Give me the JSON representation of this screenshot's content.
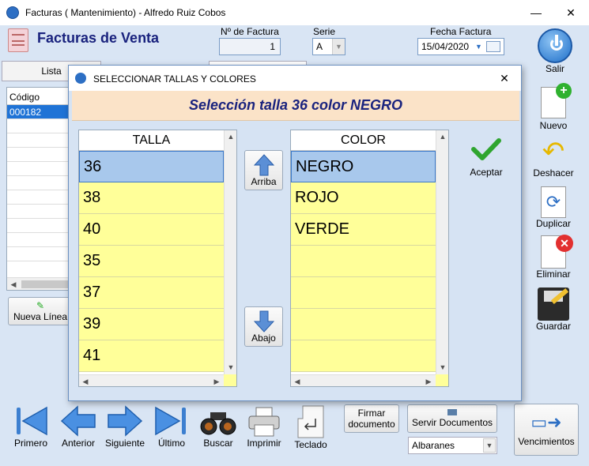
{
  "window": {
    "title": "Facturas ( Mantenimiento) - Alfredo Ruiz Cobos",
    "minimize": "—",
    "close": "✕"
  },
  "header": {
    "title": "Facturas de Venta",
    "factura_label": "Nº de Factura",
    "factura_value": "1",
    "serie_label": "Serie",
    "serie_value": "A",
    "fecha_label": "Fecha Factura",
    "fecha_value": "15/04/2020"
  },
  "left_panel": {
    "tab_lista": "Lista",
    "col_codigo": "Código",
    "rows": [
      "000182",
      "",
      "",
      "",
      "",
      "",
      "",
      "",
      "",
      "",
      ""
    ],
    "nueva_linea": "Nueva Línea"
  },
  "sidebar": {
    "salir": "Salir",
    "nuevo": "Nuevo",
    "deshacer": "Deshacer",
    "duplicar": "Duplicar",
    "eliminar": "Eliminar",
    "guardar": "Guardar"
  },
  "bottom": {
    "primero": "Primero",
    "anterior": "Anterior",
    "siguiente": "Siguiente",
    "ultimo": "Último",
    "buscar": "Buscar",
    "imprimir": "Imprimir",
    "teclado": "Teclado",
    "firmar": "Firmar\ndocumento",
    "servir": "Servir Documentos",
    "albaranes": "Albaranes",
    "vencimientos": "Vencimientos"
  },
  "dialog": {
    "title": "SELECCIONAR TALLAS Y COLORES",
    "close": "✕",
    "heading": "Selección  talla 36 color NEGRO",
    "talla_header": "TALLA",
    "color_header": "COLOR",
    "tallas": [
      "36",
      "38",
      "40",
      "35",
      "37",
      "39",
      "41"
    ],
    "colores": [
      "NEGRO",
      "ROJO",
      "VERDE",
      "",
      "",
      "",
      ""
    ],
    "arriba": "Arriba",
    "abajo": "Abajo",
    "aceptar": "Aceptar"
  },
  "colors": {
    "accent": "#1a237e",
    "row_yellow": "#ffff99",
    "row_selected": "#a8c8ec",
    "dialog_bg": "#d6e3f3",
    "heading_bg": "#fbe3c8"
  }
}
